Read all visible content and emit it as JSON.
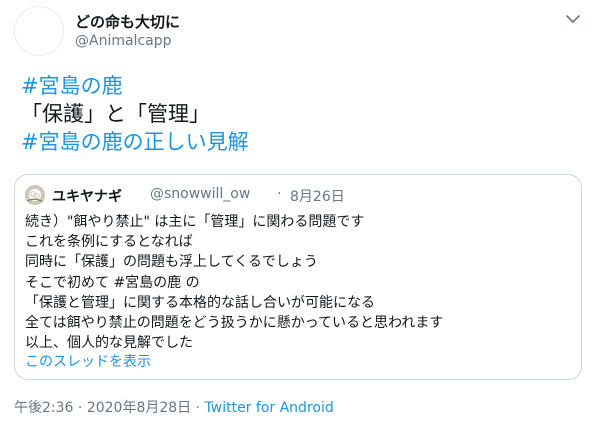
{
  "author": {
    "display_name": "どの命も大切に",
    "handle": "@Animalcapp"
  },
  "icons": {
    "menu": "chevron-down-icon",
    "avatar": "profile-avatar",
    "quoted_avatar": "profile-avatar-photo"
  },
  "colors": {
    "link": "#1b95e0",
    "secondary_text": "#657786",
    "border": "#ccd6dd",
    "text": "#14171a"
  },
  "tweet": {
    "line1": "#宮島の鹿",
    "line2": "「保護」と「管理」",
    "line3": "#宮島の鹿の正しい見解"
  },
  "quoted": {
    "display_name": "ユキヤナギ",
    "handle": "@snowwill_ow",
    "separator": "·",
    "date": "8月26日",
    "lines": [
      "続き）\"餌やり禁止\" は主に「管理」に関わる問題です",
      "これを条例にするとなれば",
      "同時に「保護」の問題も浮上してくるでしょう",
      "そこで初めて #宮島の鹿 の",
      "「保護と管理」に関する本格的な話し合いが可能になる",
      "全ては餌やり禁止の問題をどう扱うかに懸かっていると思われます",
      "以上、個人的な見解でした"
    ],
    "show_thread": "このスレッドを表示"
  },
  "meta": {
    "time": "午後2:36",
    "separator1": " · ",
    "date": "2020年8月28日",
    "separator2": " · ",
    "source": "Twitter for Android"
  }
}
